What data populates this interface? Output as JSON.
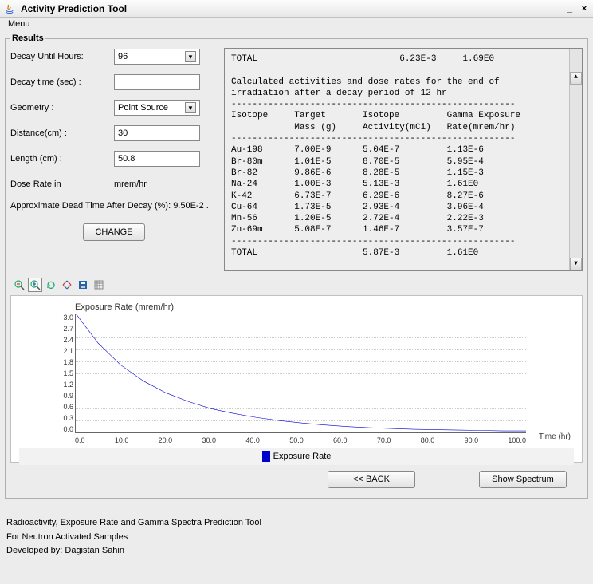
{
  "window": {
    "title": "Activity Prediction Tool",
    "minimize": "_",
    "close": "×"
  },
  "menubar": {
    "menu": "Menu"
  },
  "panel_legend": "Results",
  "form": {
    "decay_until_label": "Decay Until Hours:",
    "decay_until_value": "96",
    "decay_time_label": "Decay time (sec) :",
    "decay_time_value": "",
    "geometry_label": "Geometry :",
    "geometry_value": "Point Source",
    "distance_label": "Distance(cm) :",
    "distance_value": "30",
    "length_label": "Length (cm) :",
    "length_value": "50.8",
    "dose_rate_label": "Dose Rate in",
    "dose_rate_unit": "mrem/hr",
    "dead_time_label": "Approximate Dead Time After Decay (%): 9.50E-2 .",
    "change_btn": "CHANGE"
  },
  "output_text": "TOTAL                           6.23E-3     1.69E0\n\nCalculated activities and dose rates for the end of\nirradiation after a decay period of 12 hr\n------------------------------------------------------\nIsotope     Target       Isotope         Gamma Exposure\n            Mass (g)     Activity(mCi)   Rate(mrem/hr)\n------------------------------------------------------\nAu-198      7.00E-9      5.04E-7         1.13E-6\nBr-80m      1.01E-5      8.70E-5         5.95E-4\nBr-82       9.86E-6      8.28E-5         1.15E-3\nNa-24       1.00E-3      5.13E-3         1.61E0\nK-42        6.73E-7      6.29E-6         8.27E-6\nCu-64       1.73E-5      2.93E-4         3.96E-4\nMn-56       1.20E-5      2.72E-4         2.22E-3\nZn-69m      5.08E-7      1.46E-7         3.57E-7\n------------------------------------------------------\nTOTAL                    5.87E-3         1.61E0",
  "chart": {
    "title": "Exposure Rate (mrem/hr)",
    "y_ticks": [
      "3.0",
      "2.7",
      "2.4",
      "2.1",
      "1.8",
      "1.5",
      "1.2",
      "0.9",
      "0.6",
      "0.3",
      "0.0"
    ],
    "x_ticks": [
      "0.0",
      "10.0",
      "20.0",
      "30.0",
      "40.0",
      "50.0",
      "60.0",
      "70.0",
      "80.0",
      "90.0",
      "100.0"
    ],
    "x_label": "Time (hr)",
    "legend": "Exposure Rate"
  },
  "chart_data": {
    "type": "line",
    "title": "Exposure Rate (mrem/hr)",
    "xlabel": "Time (hr)",
    "ylabel": "Exposure Rate (mrem/hr)",
    "xlim": [
      0,
      100
    ],
    "ylim": [
      0,
      3.0
    ],
    "series": [
      {
        "name": "Exposure Rate",
        "x": [
          0,
          5,
          10,
          15,
          20,
          25,
          30,
          35,
          40,
          45,
          50,
          55,
          60,
          65,
          70,
          75,
          80,
          85,
          90,
          95,
          100
        ],
        "y": [
          3.0,
          2.25,
          1.7,
          1.3,
          1.0,
          0.78,
          0.6,
          0.48,
          0.38,
          0.3,
          0.24,
          0.19,
          0.15,
          0.12,
          0.1,
          0.08,
          0.07,
          0.06,
          0.05,
          0.04,
          0.04
        ]
      }
    ]
  },
  "buttons": {
    "back": "<< BACK",
    "spectrum": "Show Spectrum"
  },
  "footer": {
    "line1": "Radioactivity, Exposure Rate and Gamma Spectra Prediction Tool",
    "line2": "For Neutron Activated Samples",
    "line3": "Developed by: Dagistan Sahin"
  }
}
